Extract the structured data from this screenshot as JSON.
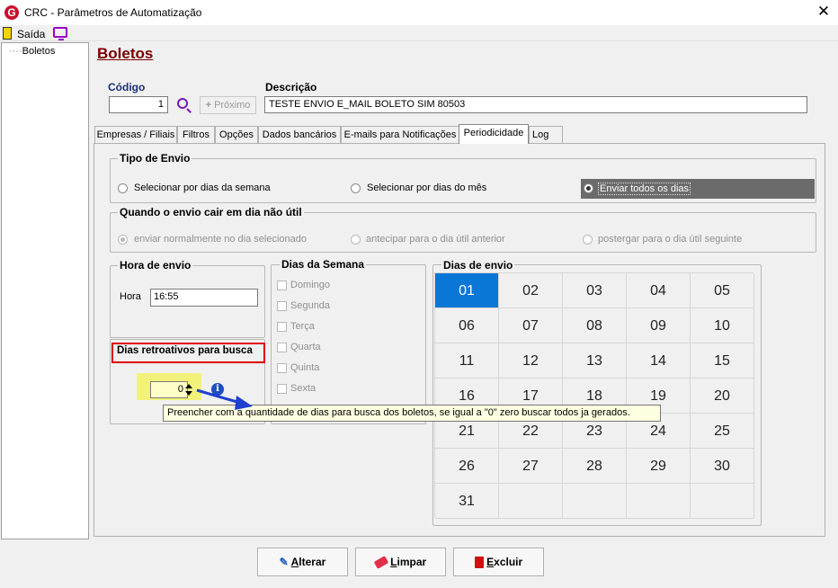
{
  "window": {
    "title": "CRC - Parâmetros de Automatização",
    "close": "✕"
  },
  "menu": {
    "exit": "Saída"
  },
  "sidebar": {
    "items": [
      {
        "label": "Boletos"
      }
    ]
  },
  "page": {
    "title": "Boletos"
  },
  "form": {
    "code_label": "Código",
    "code_value": "1",
    "next_label": "Próximo",
    "description_label": "Descrição",
    "description_value": "TESTE ENVIO  E_MAIL BOLETO SIM 80503"
  },
  "tabs": [
    {
      "label": "Empresas / Filiais"
    },
    {
      "label": "Filtros"
    },
    {
      "label": "Opções"
    },
    {
      "label": "Dados bancários"
    },
    {
      "label": "E-mails para Notificações"
    },
    {
      "label": "Periodicidade",
      "active": true
    },
    {
      "label": "Log"
    }
  ],
  "tipo_envio": {
    "title": "Tipo de Envio",
    "options": [
      {
        "label": "Selecionar por dias da semana",
        "checked": false
      },
      {
        "label": "Selecionar por dias do mês",
        "checked": false
      },
      {
        "label": "Enviar todos os dias",
        "checked": true
      }
    ]
  },
  "dia_nao_util": {
    "title": "Quando o envio cair em dia não útil",
    "options": [
      {
        "label": "enviar normalmente no dia selecionado",
        "checked": true
      },
      {
        "label": "antecipar para o dia útil anterior",
        "checked": false
      },
      {
        "label": "postergar para o dia útil seguinte",
        "checked": false
      }
    ]
  },
  "hora_envio": {
    "title": "Hora de envio",
    "label": "Hora",
    "value": "16:55"
  },
  "dias_retroativos": {
    "title": "Dias retroativos para busca",
    "value": "0",
    "info_icon": "i"
  },
  "dias_semana": {
    "title": "Dias da Semana",
    "days": [
      "Domingo",
      "Segunda",
      "Terça",
      "Quarta",
      "Quinta",
      "Sexta"
    ]
  },
  "dias_envio": {
    "title": "Dias de envio",
    "days": [
      "01",
      "02",
      "03",
      "04",
      "05",
      "06",
      "07",
      "08",
      "09",
      "10",
      "11",
      "12",
      "13",
      "14",
      "15",
      "16",
      "17",
      "18",
      "19",
      "20",
      "21",
      "22",
      "23",
      "24",
      "25",
      "26",
      "27",
      "28",
      "29",
      "30",
      "31"
    ],
    "selected": "01"
  },
  "tooltip": "Preencher com a quantidade de dias para busca dos boletos, se igual a \"0\" zero buscar todos ja gerados.",
  "buttons": {
    "alter": {
      "first": "A",
      "rest": "lterar"
    },
    "clear": {
      "first": "L",
      "rest": "impar"
    },
    "delete": {
      "first": "E",
      "rest": "xcluir"
    }
  },
  "colors": {
    "accent": "#0a76d6",
    "title_red": "#7a0000",
    "highlight_box": "#e00000",
    "arrow": "#1f3fd0"
  }
}
